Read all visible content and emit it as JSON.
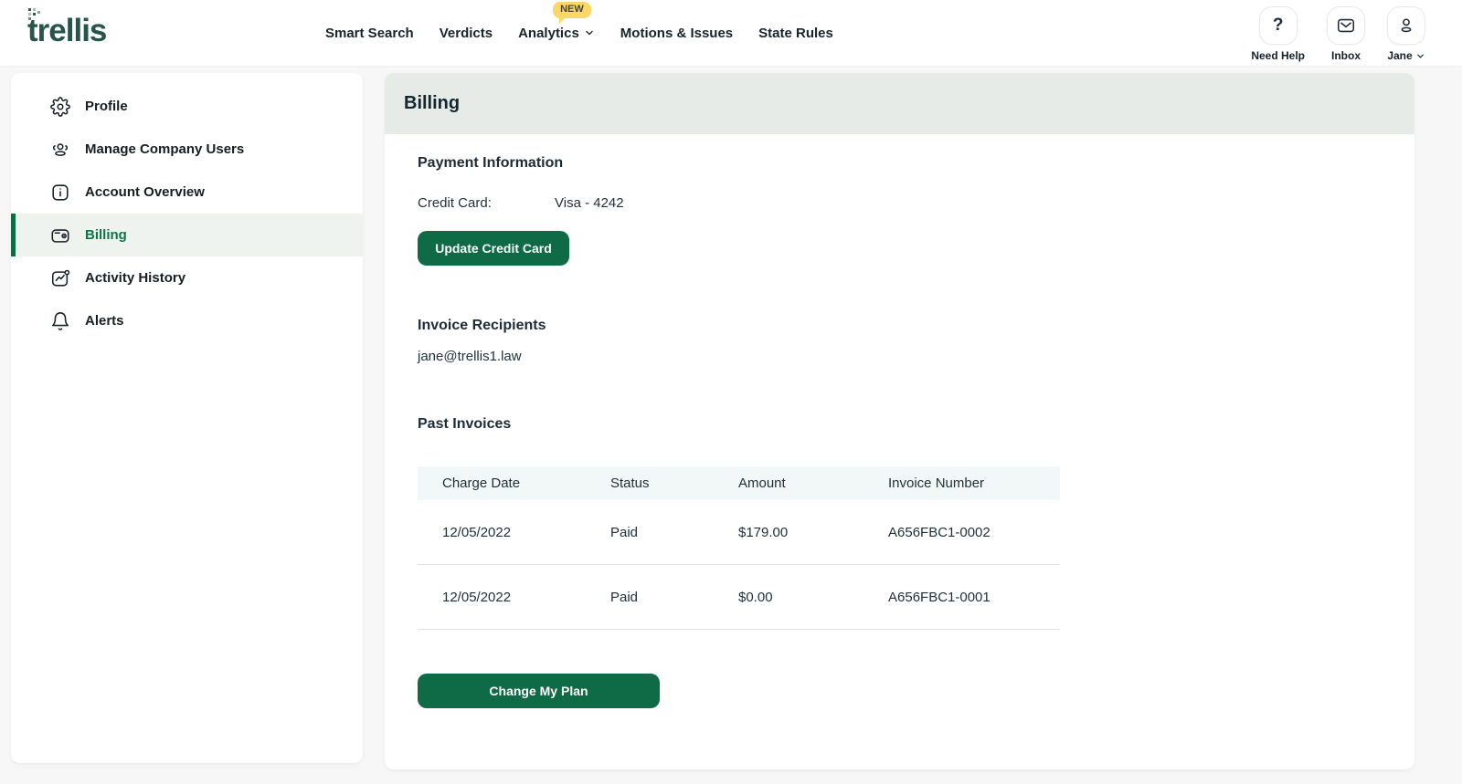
{
  "header": {
    "logo_text": "trellis",
    "nav": [
      {
        "label": "Smart Search"
      },
      {
        "label": "Verdicts"
      },
      {
        "label": "Analytics",
        "badge": "NEW",
        "has_chevron": true
      },
      {
        "label": "Motions & Issues"
      },
      {
        "label": "State Rules"
      }
    ],
    "badge_new": "NEW",
    "actions": [
      {
        "label": "Need Help",
        "icon": "question-icon"
      },
      {
        "label": "Inbox",
        "icon": "envelope-icon"
      },
      {
        "label": "Jane",
        "icon": "person-icon",
        "has_chevron": true
      }
    ]
  },
  "sidebar": {
    "items": [
      {
        "label": "Profile",
        "icon": "gear-icon",
        "selected": false
      },
      {
        "label": "Manage Company Users",
        "icon": "users-icon",
        "selected": false
      },
      {
        "label": "Account Overview",
        "icon": "info-icon",
        "selected": false
      },
      {
        "label": "Billing",
        "icon": "wallet-icon",
        "selected": true
      },
      {
        "label": "Activity History",
        "icon": "activity-icon",
        "selected": false
      },
      {
        "label": "Alerts",
        "icon": "bell-icon",
        "selected": false
      }
    ]
  },
  "main": {
    "page_title": "Billing",
    "payment": {
      "title": "Payment Information",
      "cc_label": "Credit Card:",
      "cc_value": "Visa - 4242",
      "update_button": "Update Credit Card"
    },
    "recipients": {
      "title": "Invoice Recipients",
      "email": "jane@trellis1.law"
    },
    "invoices": {
      "title": "Past Invoices",
      "columns": [
        "Charge Date",
        "Status",
        "Amount",
        "Invoice Number"
      ],
      "rows": [
        [
          "12/05/2022",
          "Paid",
          "$179.00",
          "A656FBC1-0002"
        ],
        [
          "12/05/2022",
          "Paid",
          "$0.00",
          "A656FBC1-0001"
        ]
      ],
      "change_plan_button": "Change My Plan"
    }
  },
  "colors": {
    "brand_green": "#0f6b45",
    "logo_green": "#275548",
    "selected_text_green": "#0e7647",
    "band_sage": "#e6ebe8",
    "selected_bg": "#eef3f0",
    "badge_yellow": "#fbd768",
    "table_header_bg": "#f2f7f7",
    "page_bg": "#f7f7f8"
  }
}
